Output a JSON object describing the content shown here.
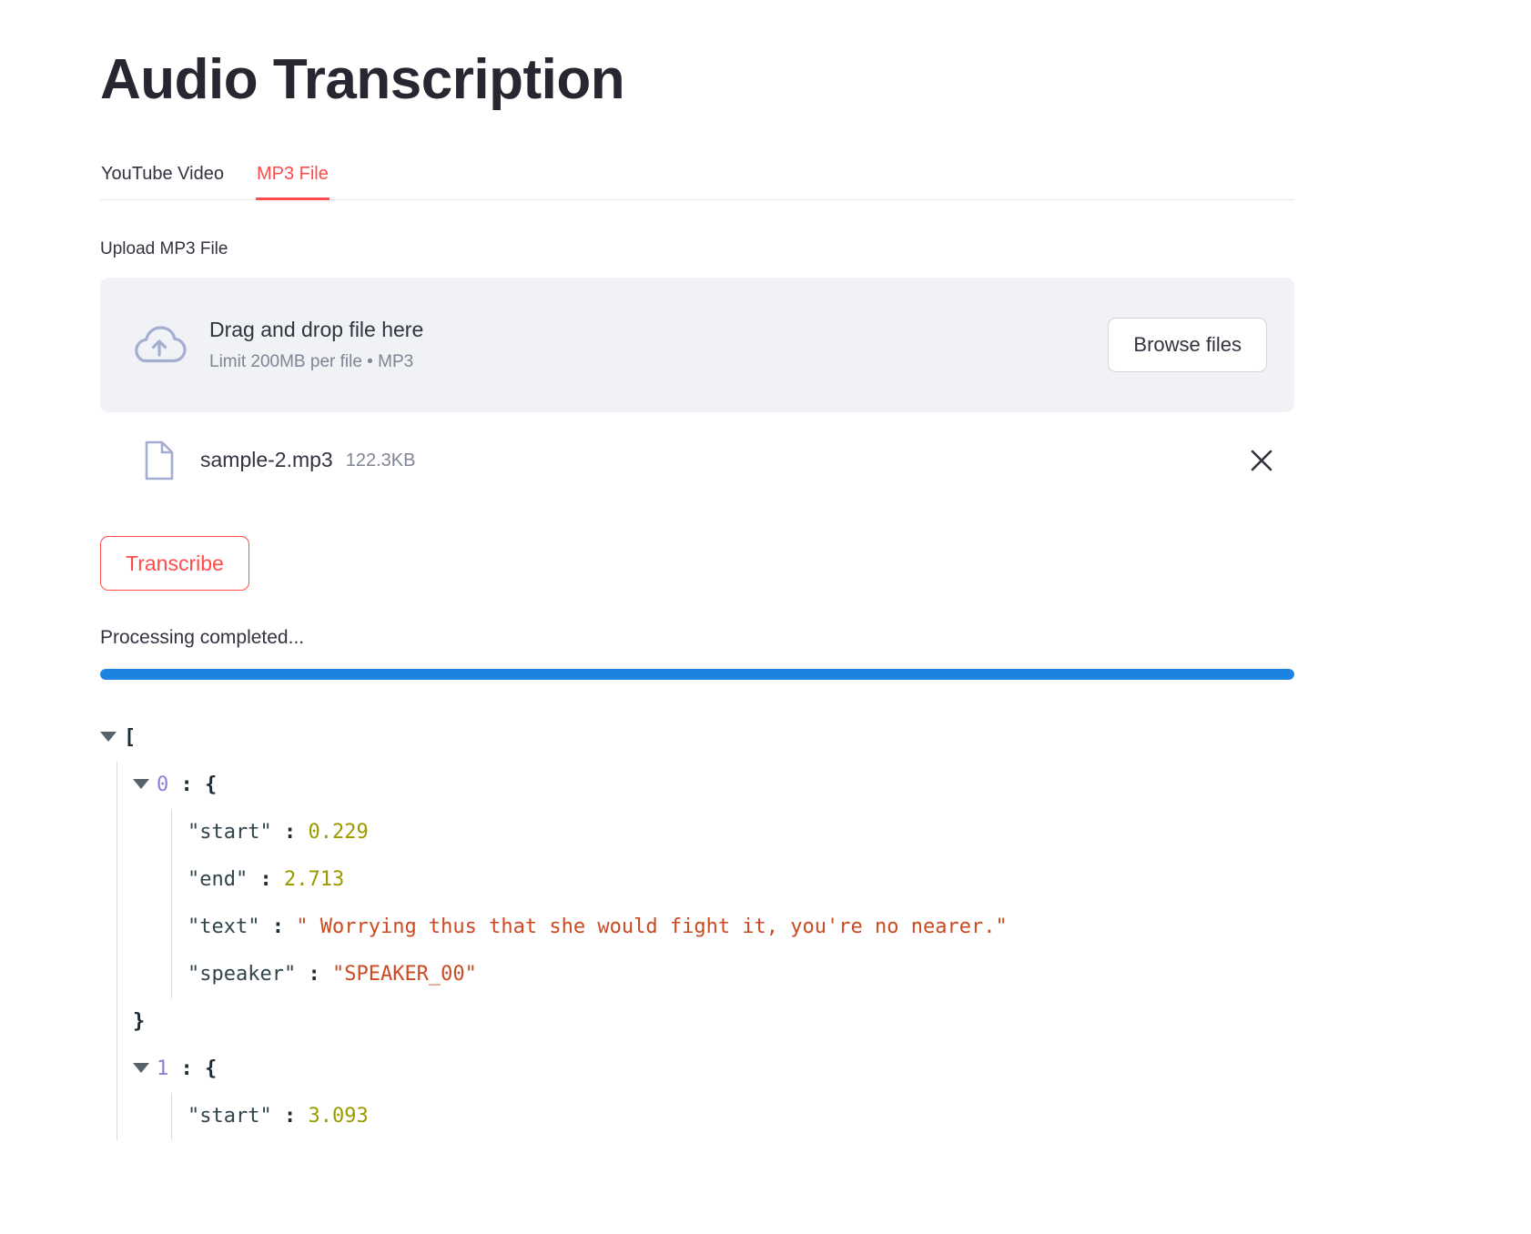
{
  "header": {
    "title": "Audio Transcription"
  },
  "tabs": [
    {
      "label": "YouTube Video",
      "active": false
    },
    {
      "label": "MP3 File",
      "active": true
    }
  ],
  "uploader": {
    "label": "Upload MP3 File",
    "drag_text": "Drag and drop file here",
    "limit_text": "Limit 200MB per file • MP3",
    "browse_label": "Browse files",
    "cloud_icon": "cloud-upload-icon"
  },
  "uploaded_file": {
    "name": "sample-2.mp3",
    "size": "122.3KB",
    "file_icon": "document-icon",
    "remove_icon": "close-icon"
  },
  "actions": {
    "transcribe_label": "Transcribe"
  },
  "status": {
    "text": "Processing completed...",
    "progress_percent": 100,
    "progress_color": "#1c83e1"
  },
  "json_viewer": {
    "open_bracket": "[",
    "close_brace": "}",
    "colon": ":",
    "open_brace": "{",
    "entries": [
      {
        "index": "0",
        "fields": [
          {
            "key": "\"start\"",
            "value": "0.229",
            "type": "number"
          },
          {
            "key": "\"end\"",
            "value": "2.713",
            "type": "number"
          },
          {
            "key": "\"text\"",
            "value": "\" Worrying thus that she would fight it, you're no nearer.\"",
            "type": "string"
          },
          {
            "key": "\"speaker\"",
            "value": "\"SPEAKER_00\"",
            "type": "string"
          }
        ]
      },
      {
        "index": "1",
        "fields": [
          {
            "key": "\"start\"",
            "value": "3.093",
            "type": "number"
          }
        ]
      }
    ]
  },
  "colors": {
    "accent_red": "#ff4b4b",
    "progress_blue": "#1c83e1",
    "text_dark": "#31333f",
    "muted": "#808495",
    "dropzone_bg": "#f0f2f6"
  }
}
